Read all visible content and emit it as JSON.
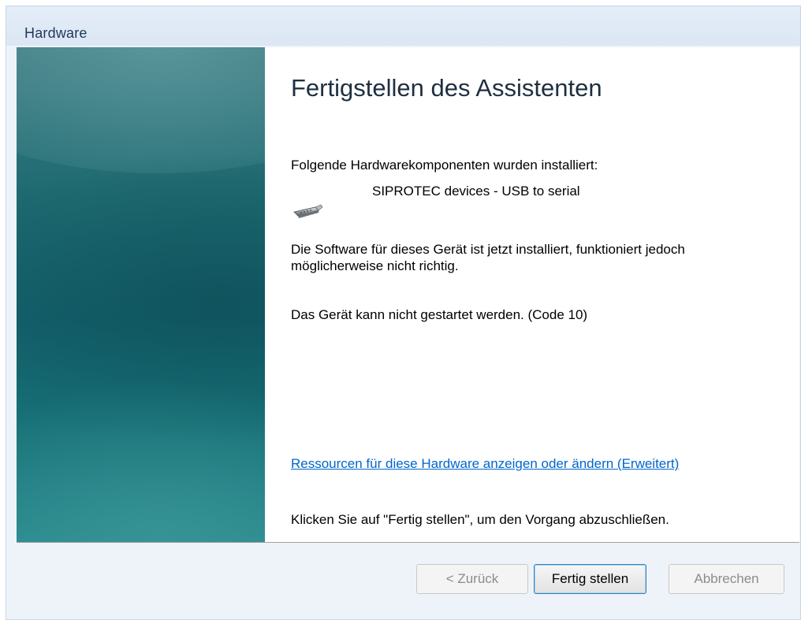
{
  "window": {
    "title": "Hardware"
  },
  "wizard": {
    "heading": "Fertigstellen des Assistenten",
    "intro": "Folgende Hardwarekomponenten wurden installiert:",
    "device_name": "SIPROTEC devices - USB to serial",
    "device_icon": "serial-connector-icon",
    "status_text": "Die Software für dieses Gerät ist jetzt installiert, funktioniert jedoch möglicherweise nicht richtig.",
    "error_text": "Das Gerät kann nicht gestartet werden. (Code 10)",
    "resources_link": "Ressourcen für diese Hardware anzeigen oder ändern (Erweitert)",
    "finish_text": "Klicken Sie auf \"Fertig stellen\", um den Vorgang abzuschließen."
  },
  "buttons": {
    "back": "< Zurück",
    "finish": "Fertig stellen",
    "cancel": "Abbrechen"
  },
  "colors": {
    "sidebar": "#14636e",
    "link": "#0066cc",
    "title": "#1e395b"
  }
}
